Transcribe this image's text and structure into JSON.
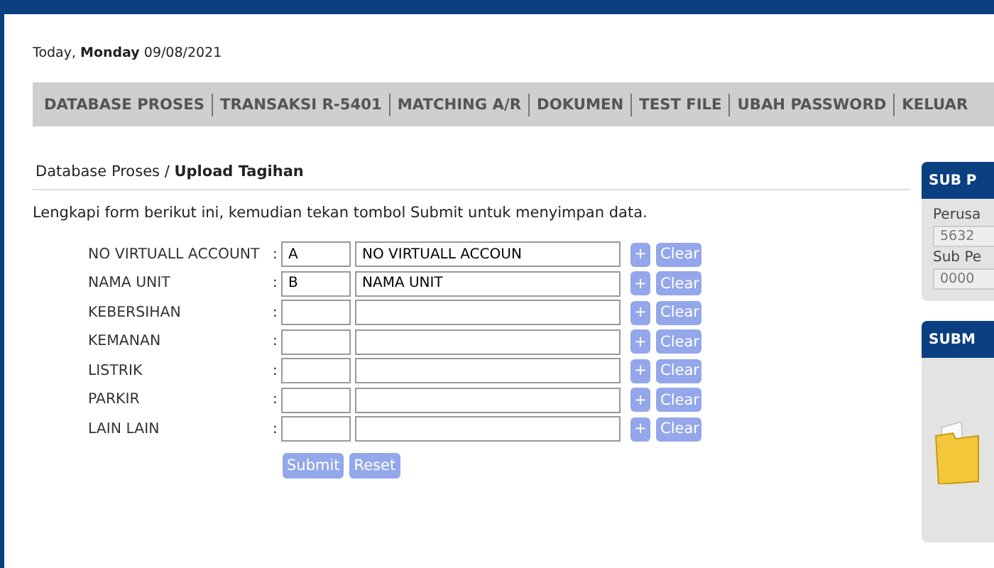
{
  "date": {
    "prefix": "Today,",
    "day": "Monday",
    "date": "09/08/2021"
  },
  "nav": [
    "DATABASE PROSES",
    "TRANSAKSI R-5401",
    "MATCHING A/R",
    "DOKUMEN",
    "TEST FILE",
    "UBAH PASSWORD",
    "KELUAR"
  ],
  "breadcrumb": {
    "parent": "Database Proses",
    "separator": "/",
    "current": "Upload Tagihan"
  },
  "instruction": "Lengkapi form berikut ini, kemudian tekan tombol Submit untuk menyimpan data.",
  "form_rows": [
    {
      "label": "NO VIRTUALL ACCOUNT",
      "colon": ":",
      "code": "A",
      "name": "NO VIRTUALL ACCOUN",
      "add": "+",
      "clear": "Clear"
    },
    {
      "label": "NAMA UNIT",
      "colon": ":",
      "code": "B",
      "name": "NAMA UNIT",
      "add": "+",
      "clear": "Clear"
    },
    {
      "label": "KEBERSIHAN",
      "colon": ":",
      "add": "+",
      "clear": "Clear"
    },
    {
      "label": "KEMANAN",
      "colon": ":",
      "add": "+",
      "clear": "Clear"
    },
    {
      "label": "LISTRIK",
      "colon": ":",
      "add": "+",
      "clear": "Clear"
    },
    {
      "label": "PARKIR",
      "colon": ":",
      "add": "+",
      "clear": "Clear"
    },
    {
      "label": "LAIN LAIN",
      "colon": ":",
      "add": "+",
      "clear": "Clear"
    }
  ],
  "buttons": [
    "Submit",
    "Reset"
  ],
  "side_panels": [
    {
      "kind": "fields",
      "title": "SUB P",
      "items": [
        {
          "label": "Perusa",
          "value": "5632"
        },
        {
          "label": "Sub Pe",
          "value": "0000"
        }
      ]
    },
    {
      "kind": "upload",
      "title": "SUBM"
    }
  ]
}
